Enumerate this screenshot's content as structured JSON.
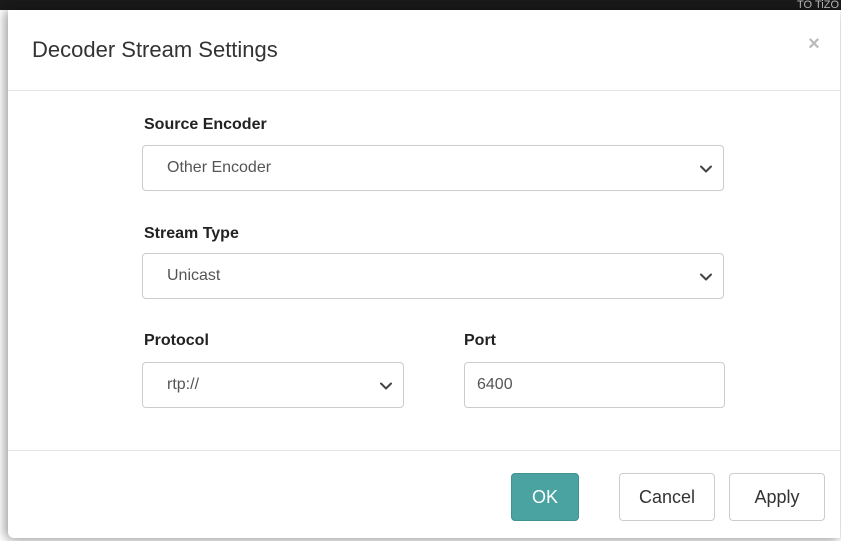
{
  "background": {
    "corner_text": "TO TiZO"
  },
  "dialog": {
    "title": "Decoder Stream Settings",
    "close_glyph": "×",
    "fields": {
      "source_encoder": {
        "label": "Source Encoder",
        "selected": "Other Encoder"
      },
      "stream_type": {
        "label": "Stream Type",
        "selected": "Unicast"
      },
      "protocol": {
        "label": "Protocol",
        "selected": "rtp://"
      },
      "port": {
        "label": "Port",
        "value": "6400"
      }
    },
    "buttons": {
      "ok": "OK",
      "cancel": "Cancel",
      "apply": "Apply"
    }
  },
  "colors": {
    "primary": "#4aa3a1",
    "border": "#cccccc",
    "text": "#333333"
  }
}
